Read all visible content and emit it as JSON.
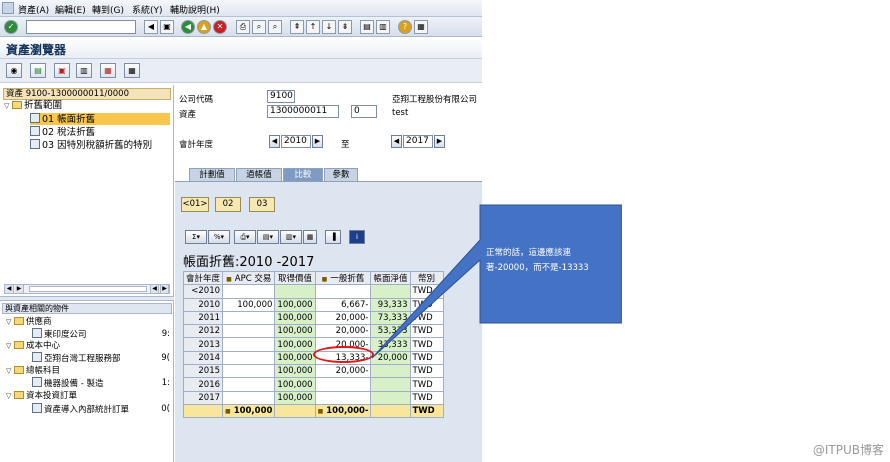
{
  "menu": {
    "items": [
      "資產(A)",
      "編輯(E)",
      "轉到(G)",
      "系統(Y)",
      "輔助說明(H)"
    ]
  },
  "page_title": "資產瀏覽器",
  "tree": {
    "header": "資產 9100-1300000011/0000",
    "root_label": "折舊範圍",
    "items": [
      {
        "code": "01",
        "label": "帳面折舊"
      },
      {
        "code": "02",
        "label": "稅法折舊"
      },
      {
        "code": "03",
        "label": "因特別稅額折舊的特別"
      }
    ]
  },
  "related": {
    "header": "與資產相關的物件",
    "groups": [
      {
        "label": "供應商",
        "child": "東印度公司",
        "value": "9:"
      },
      {
        "label": "成本中心",
        "child": "亞翔台灣工程服務部",
        "value": "9("
      },
      {
        "label": "總帳科目",
        "child": "機器設備 - 製造",
        "value": "1:"
      },
      {
        "label": "資本投資訂單",
        "child": "資產導入內部統計訂單",
        "value": "0("
      }
    ]
  },
  "form": {
    "company_code_label": "公司代碼",
    "company_code": "9100",
    "company_name": "亞翔工程股份有限公司",
    "asset_label": "資產",
    "asset_number": "1300000011",
    "asset_sub": "0",
    "asset_desc": "test",
    "fiscal_year_label": "會計年度",
    "year_from": "2010",
    "to_label": "至",
    "year_to": "2017"
  },
  "tabs": [
    "計劃值",
    "過帳值",
    "比較",
    "參數"
  ],
  "range_buttons": [
    "<01>",
    "02",
    "03"
  ],
  "report_title": "帳面折舊:2010 -2017",
  "grid": {
    "columns": [
      "會計年度",
      "APC 交易",
      "取得價值",
      "一般折舊",
      "帳面淨值",
      "幣別"
    ],
    "rows": [
      {
        "year": "<2010",
        "apc": "",
        "acq": "",
        "dep": "",
        "nbv": "",
        "cur": "TWD"
      },
      {
        "year": "2010",
        "apc": "100,000",
        "acq": "100,000",
        "dep": "6,667-",
        "nbv": "93,333",
        "cur": "TWD"
      },
      {
        "year": "2011",
        "apc": "",
        "acq": "100,000",
        "dep": "20,000-",
        "nbv": "73,333",
        "cur": "TWD"
      },
      {
        "year": "2012",
        "apc": "",
        "acq": "100,000",
        "dep": "20,000-",
        "nbv": "53,333",
        "cur": "TWD"
      },
      {
        "year": "2013",
        "apc": "",
        "acq": "100,000",
        "dep": "20,000-",
        "nbv": "33,333",
        "cur": "TWD"
      },
      {
        "year": "2014",
        "apc": "",
        "acq": "100,000",
        "dep": "13,333-",
        "nbv": "20,000",
        "cur": "TWD"
      },
      {
        "year": "2015",
        "apc": "",
        "acq": "100,000",
        "dep": "20,000-",
        "nbv": "",
        "cur": "TWD"
      },
      {
        "year": "2016",
        "apc": "",
        "acq": "100,000",
        "dep": "",
        "nbv": "",
        "cur": "TWD"
      },
      {
        "year": "2017",
        "apc": "",
        "acq": "100,000",
        "dep": "",
        "nbv": "",
        "cur": "TWD"
      }
    ],
    "total": {
      "apc": "100,000",
      "dep": "100,000-",
      "cur": "TWD"
    }
  },
  "callout": {
    "text": "正常的話，這邊應該連著-20000，而不是-13333",
    "color": "#4472c4"
  },
  "watermark": "@ITPUB博客"
}
